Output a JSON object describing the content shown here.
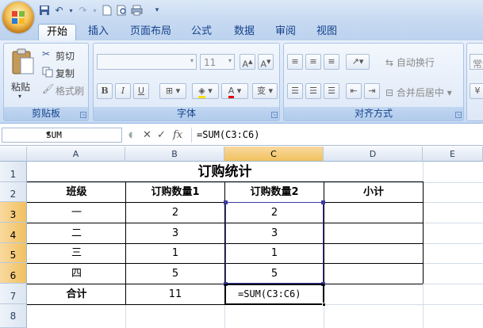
{
  "app": {
    "quick_access_icons": [
      "save-icon",
      "undo-icon",
      "redo-icon",
      "new-icon",
      "print-preview-icon",
      "print-icon",
      "customize-icon"
    ]
  },
  "tabs": [
    {
      "label": "开始",
      "active": true
    },
    {
      "label": "插入"
    },
    {
      "label": "页面布局"
    },
    {
      "label": "公式"
    },
    {
      "label": "数据"
    },
    {
      "label": "审阅"
    },
    {
      "label": "视图"
    }
  ],
  "ribbon": {
    "clipboard": {
      "paste": "粘贴",
      "cut": "剪切",
      "copy": "复制",
      "format_painter": "格式刷",
      "label": "剪贴板"
    },
    "font": {
      "font_name": "",
      "font_size": "11",
      "bold": "B",
      "italic": "I",
      "underline": "U",
      "label": "字体",
      "phonetic": "变"
    },
    "alignment": {
      "wrap": "自动换行",
      "merge": "合并后居中",
      "label": "对齐方式"
    },
    "number": {
      "format": "常规"
    }
  },
  "formula_bar": {
    "name_box": "SUM",
    "cancel": "✕",
    "enter": "✓",
    "fx": "fx",
    "formula": "=SUM(C3:C6)"
  },
  "sheet": {
    "columns": [
      "A",
      "B",
      "C",
      "D",
      "E"
    ],
    "rows": [
      "1",
      "2",
      "3",
      "4",
      "5",
      "6",
      "7",
      "8"
    ],
    "title": "订购统计",
    "headers": [
      "班级",
      "订购数量1",
      "订购数量2",
      "小计"
    ],
    "data": [
      [
        "一",
        "2",
        "2",
        ""
      ],
      [
        "二",
        "3",
        "3",
        ""
      ],
      [
        "三",
        "1",
        "1",
        ""
      ],
      [
        "四",
        "5",
        "5",
        ""
      ]
    ],
    "total": {
      "label": "合计",
      "b": "11",
      "c": "=SUM(C3:C6)"
    }
  },
  "colors": {
    "selection": "#3c3ca0",
    "header_selected": "#f1c15f"
  }
}
